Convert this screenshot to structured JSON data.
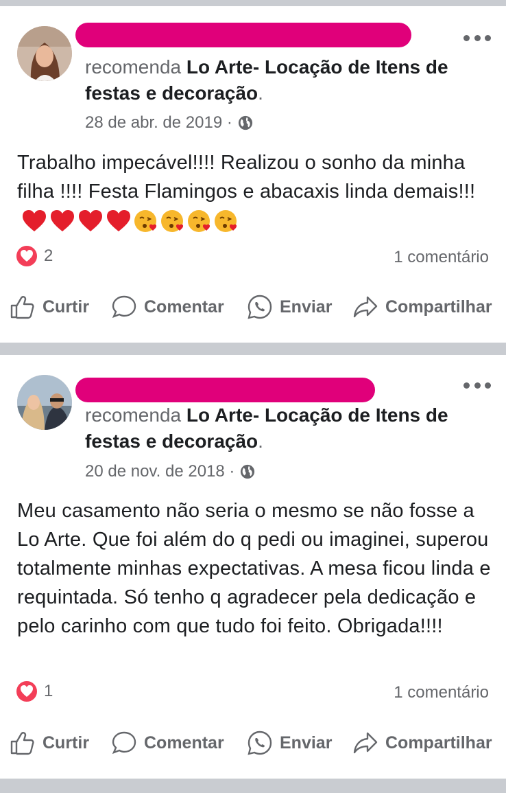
{
  "posts": [
    {
      "recommend_text": "recomenda",
      "page_name": "Lo Arte- Locação de Itens de festas e decoração",
      "date": "28 de abr. de 2019 ·",
      "body": "Trabalho impecável!!!! Realizou o sonho da minha filha !!!! Festa Flamingos e abacaxis linda demais!!!",
      "emojis": [
        "red-heart",
        "red-heart",
        "red-heart",
        "red-heart",
        "kissing-face",
        "kissing-face",
        "kissing-face",
        "kissing-face"
      ],
      "reaction_count": "2",
      "comments": "1 comentário"
    },
    {
      "recommend_text": "recomenda",
      "page_name": "Lo Arte- Locação de Itens de festas e decoração",
      "date": "20 de nov. de 2018 ·",
      "body": "Meu casamento não seria o mesmo se não fosse a Lo Arte. Que foi além do q pedi ou imaginei, superou totalmente minhas expectativas. A mesa ficou linda e requintada. Só tenho q agradecer pela dedicação e pelo carinho com que tudo foi feito. Obrigada!!!!",
      "reaction_count": "1",
      "comments": "1 comentário"
    }
  ],
  "actions": {
    "like": "Curtir",
    "comment": "Comentar",
    "send": "Enviar",
    "share": "Compartilhar"
  },
  "colors": {
    "redaction": "#e0007a",
    "love_reaction": "#f33e58",
    "secondary_text": "#65676b"
  }
}
